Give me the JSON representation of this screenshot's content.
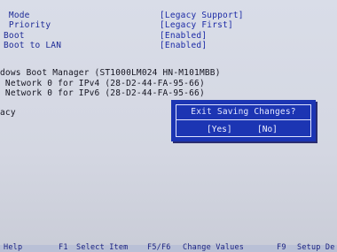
{
  "settings": [
    {
      "label": " Mode",
      "value": "[Legacy Support]"
    },
    {
      "label": " Priority",
      "value": "[Legacy First]"
    },
    {
      "label": "Boot",
      "value": "[Enabled]"
    },
    {
      "label": "Boot to LAN",
      "value": "[Enabled]"
    }
  ],
  "boot_order": [
    "dows Boot Manager (ST1000LM024 HN-M101MBB)",
    " Network 0 for IPv4 (28-D2-44-FA-95-66)",
    " Network 0 for IPv6 (28-D2-44-FA-95-66)"
  ],
  "section_label": "acy",
  "dialog": {
    "title": "Exit Saving Changes?",
    "yes_label": "[Yes]",
    "no_label": "[No]"
  },
  "footer": {
    "help": "Help",
    "f1": "F1",
    "select_item": "Select Item",
    "f5f6": "F5/F6",
    "change_values": "Change Values",
    "f9": "F9",
    "setup_defaults": "Setup De"
  },
  "colors": {
    "background": "#d4d7e2",
    "label_text": "#1d2a96",
    "dialog_bg": "#1c35b3",
    "dialog_text": "#e6e9ff"
  }
}
